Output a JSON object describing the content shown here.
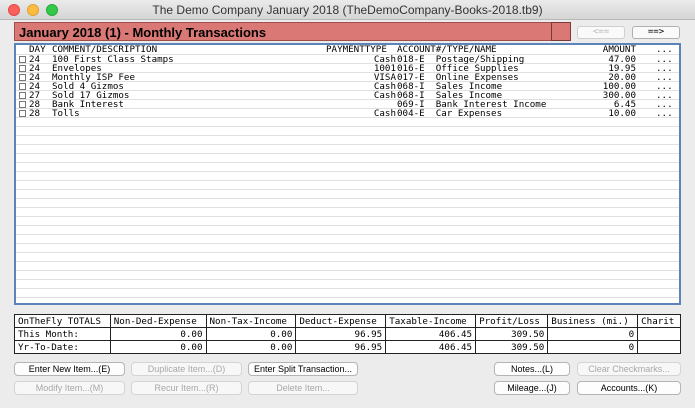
{
  "window": {
    "title": "The Demo Company  January 2018  (TheDemoCompany-Books-2018.tb9)"
  },
  "header": {
    "title": "January 2018 (1) - Monthly Transactions",
    "prev_label": "<==",
    "next_label": "==>"
  },
  "list": {
    "columns": {
      "day": "DAY",
      "desc": "COMMENT/DESCRIPTION",
      "pay": "PAYMENTTYPE",
      "acct": "ACCOUNT#/TYPE/NAME",
      "amount": "AMOUNT",
      "more": "..."
    },
    "rows": [
      {
        "day": "24",
        "desc": "100 First Class Stamps",
        "pay": "Cash",
        "acct": "018-E  Postage/Shipping",
        "amount": "47.00",
        "more": "..."
      },
      {
        "day": "24",
        "desc": "Envelopes",
        "pay": "1001",
        "acct": "016-E  Office Supplies",
        "amount": "19.95",
        "more": "..."
      },
      {
        "day": "24",
        "desc": "Monthly ISP Fee",
        "pay": "VISA",
        "acct": "017-E  Online Expenses",
        "amount": "20.00",
        "more": "..."
      },
      {
        "day": "24",
        "desc": "Sold 4 Gizmos",
        "pay": "Cash",
        "acct": "068-I  Sales Income",
        "amount": "100.00",
        "more": "..."
      },
      {
        "day": "27",
        "desc": "Sold 17 Gizmos",
        "pay": "Cash",
        "acct": "068-I  Sales Income",
        "amount": "300.00",
        "more": "..."
      },
      {
        "day": "28",
        "desc": "Bank Interest",
        "pay": "",
        "acct": "069-I  Bank Interest Income",
        "amount": "6.45",
        "more": "..."
      },
      {
        "day": "28",
        "desc": "Tolls",
        "pay": "Cash",
        "acct": "004-E  Car Expenses",
        "amount": "10.00",
        "more": "..."
      }
    ]
  },
  "totals": {
    "headers": [
      "OnTheFly TOTALS",
      "Non-Ded-Expense",
      "Non-Tax-Income",
      "Deduct-Expense",
      "Taxable-Income",
      "Profit/Loss",
      "Business (mi.)",
      "Charit"
    ],
    "this_month": [
      "This Month:",
      "0.00",
      "0.00",
      "96.95",
      "406.45",
      "309.50",
      "0",
      ""
    ],
    "ytd": [
      "Yr-To-Date:",
      "0.00",
      "0.00",
      "96.95",
      "406.45",
      "309.50",
      "0",
      ""
    ]
  },
  "buttons": {
    "enter_new": "Enter New Item...(E)",
    "duplicate": "Duplicate Item...(D)",
    "enter_split": "Enter Split Transaction...",
    "notes": "Notes...(L)",
    "clear_checkmarks": "Clear Checkmarks...",
    "modify": "Modify Item...(M)",
    "recur": "Recur Item...(R)",
    "delete": "Delete Item...",
    "mileage": "Mileage...(J)",
    "accounts": "Accounts...(K)"
  }
}
